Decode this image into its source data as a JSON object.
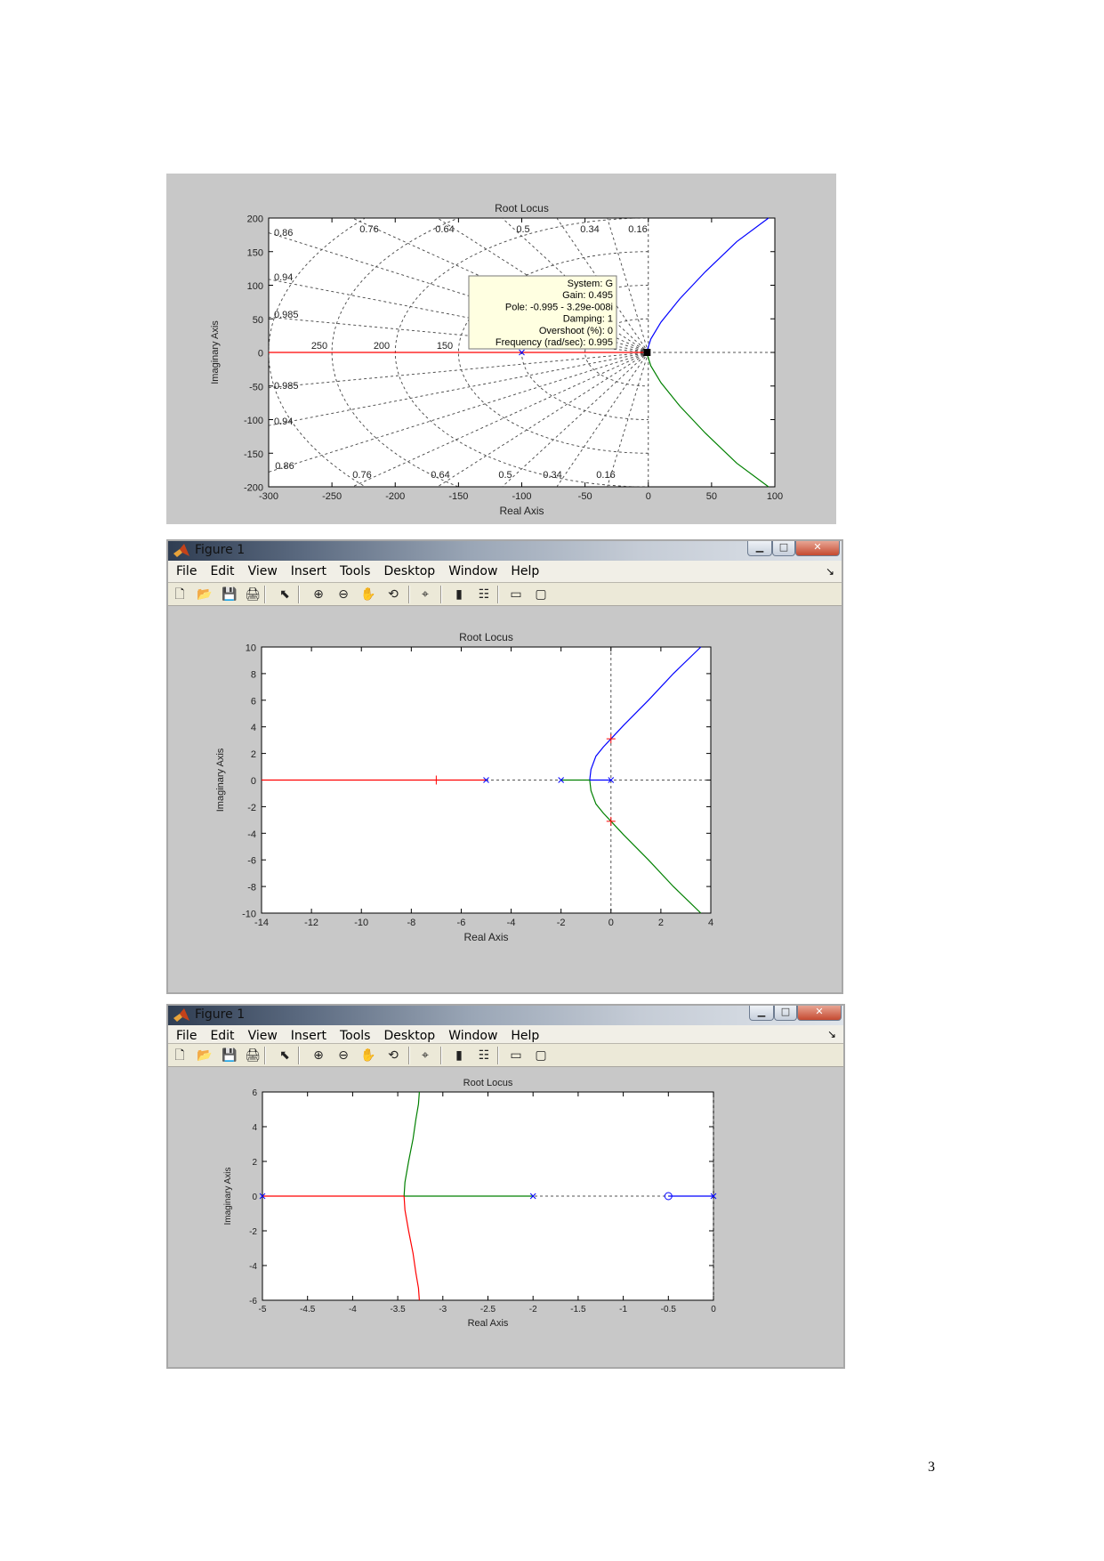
{
  "page": {
    "page_number": "3"
  },
  "window": {
    "title": "Figure 1",
    "menu": [
      "File",
      "Edit",
      "View",
      "Insert",
      "Tools",
      "Desktop",
      "Window",
      "Help"
    ],
    "toolbar_icons": [
      "new-figure-icon",
      "open-file-icon",
      "save-icon",
      "print-icon",
      "edit-plot-arrow-icon",
      "zoom-in-icon",
      "zoom-out-icon",
      "pan-hand-icon",
      "rotate-3d-icon",
      "data-cursor-icon",
      "colorbar-icon",
      "legend-icon",
      "hide-plot-tools-icon",
      "show-plot-tools-icon"
    ]
  },
  "colors": {
    "blue": "#0000ff",
    "green": "#008000",
    "red": "#ff0000",
    "figure_bg": "#c8c8c8",
    "tooltip_bg": "#ffffe1"
  },
  "chart_data": [
    {
      "type": "line",
      "title": "Root Locus",
      "xlabel": "Real Axis",
      "ylabel": "Imaginary Axis",
      "xlim": [
        -300,
        100
      ],
      "ylim": [
        -200,
        200
      ],
      "xticks": [
        "-300",
        "-250",
        "-200",
        "-150",
        "-100",
        "-50",
        "0",
        "50",
        "100"
      ],
      "yticks": [
        "200",
        "150",
        "100",
        "50",
        "0",
        "-50",
        "-100",
        "-150",
        "-200"
      ],
      "grid": "s-plane (damping and natural frequency)",
      "damping_labels_top": [
        "0.76",
        "0.64",
        "0.5",
        "0.34",
        "0.16"
      ],
      "damping_labels_left": [
        "0.86",
        "0.94",
        "0.985"
      ],
      "damping_labels_bottom": [
        "0.86",
        "0.76",
        "0.64",
        "0.5",
        "0.34",
        "0.16"
      ],
      "damping_labels_left_lower": [
        "0.985",
        "0.94"
      ],
      "frequency_labels": [
        "250",
        "200",
        "150"
      ],
      "series": [
        {
          "color": "blue",
          "x": [
            0,
            -0.5,
            2,
            10,
            25,
            45,
            70,
            95
          ],
          "y": [
            0,
            5,
            20,
            45,
            80,
            120,
            165,
            200
          ]
        },
        {
          "color": "green",
          "x": [
            0,
            -0.5,
            2,
            10,
            25,
            45,
            70,
            95
          ],
          "y": [
            0,
            -5,
            -20,
            -45,
            -80,
            -120,
            -165,
            -200
          ]
        },
        {
          "color": "red",
          "x": [
            -300,
            -100,
            -1
          ],
          "y": [
            0,
            0,
            0
          ]
        }
      ],
      "poles": [
        {
          "x": -100,
          "y": 0
        }
      ],
      "datatip": {
        "lines": [
          "System: G",
          "Gain: 0.495",
          "Pole: -0.995 - 3.29e-008i",
          "Damping: 1",
          "Overshoot (%): 0",
          "Frequency (rad/sec): 0.995"
        ],
        "marker": {
          "x": -0.995,
          "y": 0
        }
      }
    },
    {
      "type": "line",
      "title": "Root Locus",
      "xlabel": "Real Axis",
      "ylabel": "Imaginary Axis",
      "xlim": [
        -14,
        4
      ],
      "ylim": [
        -10,
        10
      ],
      "xticks": [
        "-14",
        "-12",
        "-10",
        "-8",
        "-6",
        "-4",
        "-2",
        "0",
        "2",
        "4"
      ],
      "yticks": [
        "10",
        "8",
        "6",
        "4",
        "2",
        "0",
        "-2",
        "-4",
        "-6",
        "-8",
        "-10"
      ],
      "series": [
        {
          "color": "blue",
          "x": [
            -0.85,
            -0.8,
            -0.6,
            -0.3,
            0,
            0.5,
            1.5,
            2.5,
            3.6
          ],
          "y": [
            0,
            0.8,
            1.8,
            2.5,
            3.1,
            4.1,
            6,
            8,
            10
          ]
        },
        {
          "color": "green",
          "x": [
            -0.85,
            -0.8,
            -0.6,
            -0.3,
            0,
            0.5,
            1.5,
            2.5,
            3.6
          ],
          "y": [
            0,
            -0.8,
            -1.8,
            -2.5,
            -3.1,
            -4.1,
            -6,
            -8,
            -10
          ]
        },
        {
          "color": "green",
          "x": [
            -2,
            -0.85
          ],
          "y": [
            0,
            0
          ]
        },
        {
          "color": "blue",
          "x": [
            -0.85,
            0
          ],
          "y": [
            0,
            0
          ]
        },
        {
          "color": "red",
          "x": [
            -14,
            -5
          ],
          "y": [
            0,
            0
          ]
        }
      ],
      "poles": [
        {
          "x": -5,
          "y": 0
        },
        {
          "x": -2,
          "y": 0
        },
        {
          "x": 0,
          "y": 0
        }
      ],
      "markers": [
        {
          "x": 0,
          "y": 3.1
        },
        {
          "x": 0,
          "y": -3.1
        },
        {
          "x": -7,
          "y": 0
        }
      ]
    },
    {
      "type": "line",
      "title": "Root Locus",
      "xlabel": "Real Axis",
      "ylabel": "Imaginary Axis",
      "xlim": [
        -5,
        0
      ],
      "ylim": [
        -6,
        6
      ],
      "xticks": [
        "-5",
        "-4.5",
        "-4",
        "-3.5",
        "-3",
        "-2.5",
        "-2",
        "-1.5",
        "-1",
        "-0.5",
        "0"
      ],
      "yticks": [
        "6",
        "4",
        "2",
        "0",
        "-2",
        "-4",
        "-6"
      ],
      "series": [
        {
          "color": "green",
          "x": [
            -3.43,
            -3.42,
            -3.38,
            -3.33,
            -3.3,
            -3.27,
            -3.26
          ],
          "y": [
            0,
            0.8,
            2,
            3.3,
            4.4,
            5.3,
            6
          ]
        },
        {
          "color": "red",
          "x": [
            -3.43,
            -3.42,
            -3.38,
            -3.33,
            -3.3,
            -3.27,
            -3.26
          ],
          "y": [
            0,
            -0.8,
            -2,
            -3.3,
            -4.4,
            -5.3,
            -6
          ]
        },
        {
          "color": "green",
          "x": [
            -3.43,
            -2
          ],
          "y": [
            0,
            0
          ]
        },
        {
          "color": "red",
          "x": [
            -5,
            -3.43
          ],
          "y": [
            0,
            0
          ]
        },
        {
          "color": "blue",
          "x": [
            -0.5,
            0
          ],
          "y": [
            0,
            0
          ]
        }
      ],
      "poles": [
        {
          "x": -5,
          "y": 0
        },
        {
          "x": -2,
          "y": 0
        },
        {
          "x": 0,
          "y": 0
        }
      ],
      "zeros": [
        {
          "x": -0.5,
          "y": 0
        }
      ]
    }
  ]
}
